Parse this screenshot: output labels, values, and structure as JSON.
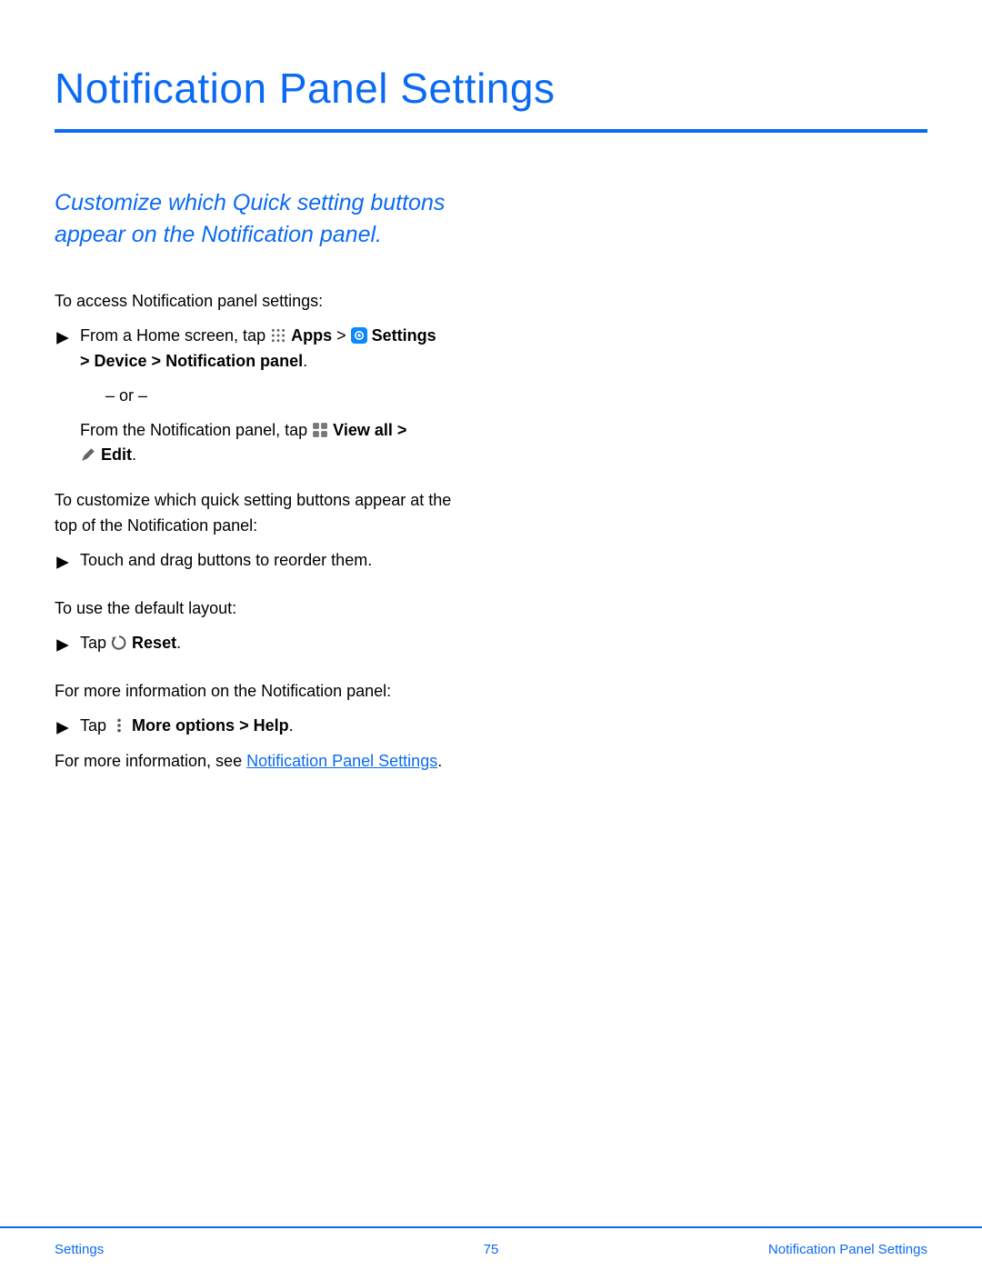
{
  "title": "Notification Panel Settings",
  "subtitle": "Customize which Quick setting buttons appear on the Notification panel.",
  "p_access_intro": "To access Notification panel settings:",
  "step1": {
    "pre": "From a Home screen, tap ",
    "apps": "Apps",
    "gt1": " > ",
    "settings": "Settings",
    "line2": "> Device > Notification panel",
    "dot": "."
  },
  "or_text": "– or –",
  "step1b": {
    "pre": "From the Notification panel, tap ",
    "viewall": "View all",
    "gt": " >",
    "edit": "Edit",
    "dot": "."
  },
  "p_customize_intro": "To customize which quick setting buttons appear at the top of the Notification panel:",
  "step2": "Touch and drag buttons to reorder them.",
  "p_default_intro": "To use the default layout:",
  "step3": {
    "pre": "Tap ",
    "reset": "Reset",
    "dot": "."
  },
  "p_moreinfo_intro": "For more information on the Notification panel:",
  "step4": {
    "pre": "Tap ",
    "more": "More options",
    "gt": " > ",
    "help": "Help",
    "dot": "."
  },
  "p_see_pre": "For more information, see ",
  "p_see_link": "Notification Panel Settings",
  "p_see_post": ".",
  "footer": {
    "left": "Settings",
    "center": "75",
    "right": "Notification Panel Settings"
  }
}
